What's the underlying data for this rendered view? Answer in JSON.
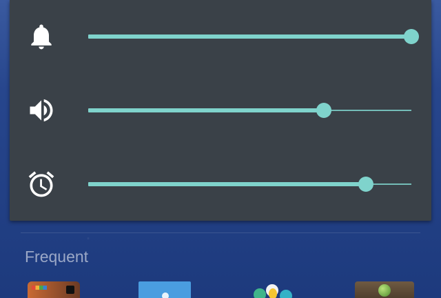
{
  "volume_panel": {
    "rows": [
      {
        "name": "ringtone",
        "icon": "bell-icon",
        "level": 1.0
      },
      {
        "name": "media",
        "icon": "speaker-icon",
        "level": 0.73
      },
      {
        "name": "alarm",
        "icon": "alarm-clock-icon",
        "level": 0.86
      }
    ],
    "accent_color": "#7fd3cc",
    "panel_color": "#3a4148"
  },
  "drawer": {
    "section_label": "Frequent",
    "apps": [
      {
        "icon": "instagram-icon"
      },
      {
        "icon": "files-icon"
      },
      {
        "icon": "photos-icon"
      },
      {
        "icon": "olive-app-icon"
      }
    ]
  }
}
